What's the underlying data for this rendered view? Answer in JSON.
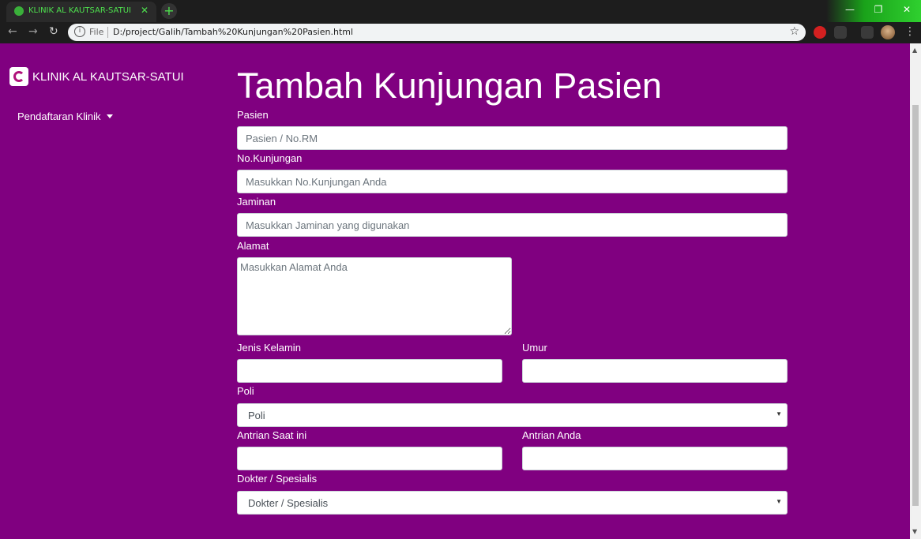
{
  "browser": {
    "tab_title": "KLINIK AL KAUTSAR-SATUI",
    "tab_close": "✕",
    "new_tab": "+",
    "scheme": "File",
    "url": "D:/project/Galih/Tambah%20Kunjungan%20Pasien.html",
    "accent_color": "#4ee04e"
  },
  "sidebar": {
    "brand": "KLINIK AL KAUTSAR-SATUI",
    "nav_dropdown": "Pendaftaran Klinik"
  },
  "main": {
    "title": "Tambah Kunjungan Pasien",
    "fields": {
      "pasien": {
        "label": "Pasien",
        "placeholder": "Pasien / No.RM"
      },
      "no_kunjungan": {
        "label": "No.Kunjungan",
        "placeholder": "Masukkan No.Kunjungan Anda"
      },
      "jaminan": {
        "label": "Jaminan",
        "placeholder": "Masukkan Jaminan yang digunakan"
      },
      "alamat": {
        "label": "Alamat",
        "placeholder": "Masukkan Alamat Anda"
      },
      "jenis_kelamin": {
        "label": "Jenis Kelamin"
      },
      "umur": {
        "label": "Umur"
      },
      "poli": {
        "label": "Poli",
        "selected": "Poli"
      },
      "antrian_saat_ini": {
        "label": "Antrian Saat ini"
      },
      "antrian_anda": {
        "label": "Antrian Anda"
      },
      "dokter": {
        "label": "Dokter / Spesialis",
        "selected": "Dokter / Spesialis"
      }
    }
  },
  "colors": {
    "page_background": "#800080",
    "text": "#ffffff"
  }
}
